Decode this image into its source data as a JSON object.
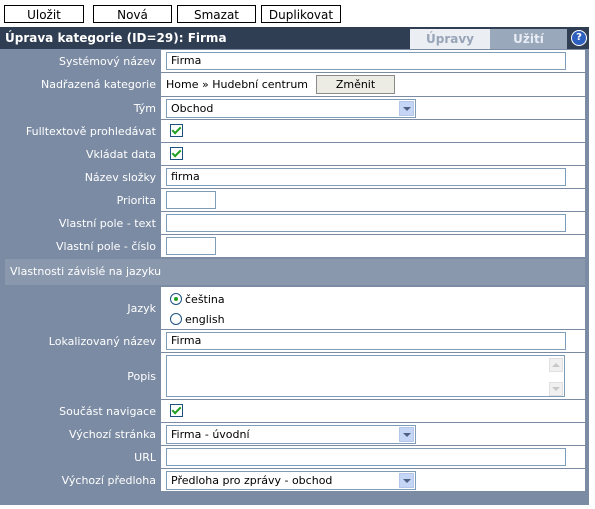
{
  "toolbar": {
    "save_label": "Uložit",
    "new_label": "Nová",
    "delete_label": "Smazat",
    "duplicate_label": "Duplikovat"
  },
  "header": {
    "title": "Úprava kategorie (ID=29): Firma",
    "tabs": [
      "Úpravy",
      "Užití"
    ],
    "help_glyph": "?"
  },
  "form": {
    "system_name": {
      "label": "Systémový název",
      "value": "Firma"
    },
    "parent_category": {
      "label": "Nadřazená kategorie",
      "path": "Home » Hudební centrum",
      "change_label": "Změnit"
    },
    "team": {
      "label": "Tým",
      "value": "Obchod"
    },
    "fulltext": {
      "label": "Fulltextově prohledávat",
      "checked": true
    },
    "insert_data": {
      "label": "Vkládat data",
      "checked": true
    },
    "folder_name": {
      "label": "Název složky",
      "value": "firma"
    },
    "priority": {
      "label": "Priorita",
      "value": ""
    },
    "custom_text": {
      "label": "Vlastní pole - text",
      "value": ""
    },
    "custom_number": {
      "label": "Vlastní pole - číslo",
      "value": ""
    },
    "lang_section": "Vlastnosti závislé na jazyku",
    "language": {
      "label": "Jazyk",
      "options": [
        "čeština",
        "english"
      ],
      "selected": "čeština"
    },
    "localized_name": {
      "label": "Lokalizovaný název",
      "value": "Firma"
    },
    "description": {
      "label": "Popis",
      "value": ""
    },
    "navigation": {
      "label": "Součást navigace",
      "checked": true
    },
    "default_page": {
      "label": "Výchozí stránka",
      "value": "Firma - úvodní"
    },
    "url": {
      "label": "URL",
      "value": ""
    },
    "default_template": {
      "label": "Výchozí předloha",
      "value": "Předloha pro zprávy - obchod"
    }
  }
}
